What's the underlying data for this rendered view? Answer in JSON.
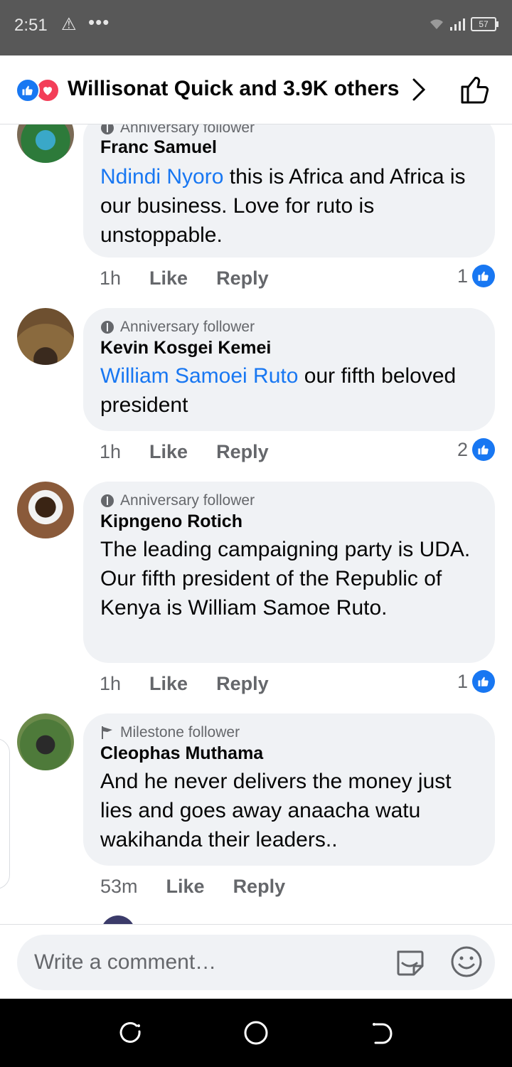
{
  "status_bar": {
    "time": "2:51",
    "battery": "57"
  },
  "header": {
    "reactions_text": "Willisonat Quick and 3.9K others"
  },
  "comments": [
    {
      "badge": "Anniversary follower",
      "author": "Franc Samuel",
      "mention": "Ndindi Nyoro",
      "text": " this is Africa and Africa is our business. Love for ruto is unstoppable.",
      "time": "1h",
      "like_label": "Like",
      "reply_label": "Reply",
      "like_count": "1"
    },
    {
      "badge": "Anniversary follower",
      "author": "Kevin Kosgei Kemei",
      "mention": "William Samoei Ruto",
      "text": " our fifth beloved president",
      "time": "1h",
      "like_label": "Like",
      "reply_label": "Reply",
      "like_count": "2"
    },
    {
      "badge": "Anniversary follower",
      "author": "Kipngeno Rotich",
      "mention": "",
      "text": "The leading campaigning party is UDA. Our fifth president of the Republic of Kenya is William Samoe Ruto.",
      "time": "1h",
      "like_label": "Like",
      "reply_label": "Reply",
      "like_count": "1"
    },
    {
      "badge": "Milestone follower",
      "author": "Cleophas Muthama",
      "mention": "",
      "text": "And he never delivers the money just lies and goes away anaacha watu wakihanda their leaders..",
      "time": "53m",
      "like_label": "Like",
      "reply_label": "Reply",
      "like_count": ""
    }
  ],
  "composer": {
    "placeholder": "Write a comment…"
  },
  "colors": {
    "accent": "#1877f2",
    "love": "#f33e58",
    "bubble": "#f0f2f5",
    "secondary_text": "#65676b"
  }
}
